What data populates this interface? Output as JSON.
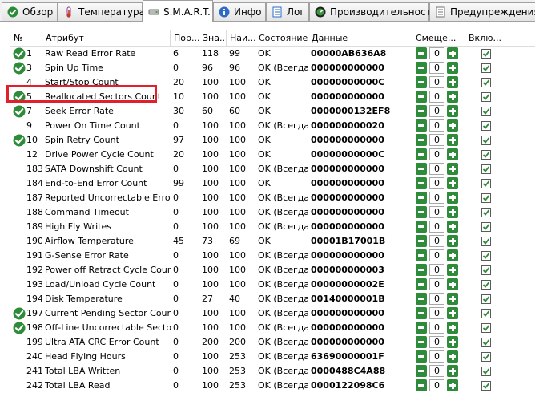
{
  "tabs": [
    {
      "label": "Обзор",
      "icon": "check-circle-icon"
    },
    {
      "label": "Температура",
      "icon": "thermometer-icon"
    },
    {
      "label": "S.M.A.R.T.",
      "icon": "drive-icon"
    },
    {
      "label": "Инфо",
      "icon": "info-icon"
    },
    {
      "label": "Лог",
      "icon": "log-icon"
    },
    {
      "label": "Производительность",
      "icon": "gauge-icon"
    },
    {
      "label": "Предупреждения",
      "icon": "warning-icon"
    }
  ],
  "columns": [
    "№",
    "Атрибут",
    "Пор...",
    "Зна...",
    "Наи...",
    "Состояние",
    "Данные",
    "Смеще...",
    "Вклю..."
  ],
  "colors": {
    "ok_green": "#2e8b3a",
    "highlight_red": "#e0202a"
  },
  "rows": [
    {
      "num": "1",
      "attr": "Raw Read Error Rate",
      "thr": "6",
      "val": "118",
      "worst": "99",
      "state": "OK",
      "data": "00000AB636A8",
      "offset": "0",
      "enabled": true,
      "ok": true
    },
    {
      "num": "3",
      "attr": "Spin Up Time",
      "thr": "0",
      "val": "96",
      "worst": "96",
      "state": "OK (Всегда...",
      "data": "000000000000",
      "offset": "0",
      "enabled": true,
      "ok": true
    },
    {
      "num": "4",
      "attr": "Start/Stop Count",
      "thr": "20",
      "val": "100",
      "worst": "100",
      "state": "OK",
      "data": "00000000000C",
      "offset": "0",
      "enabled": true,
      "ok": false
    },
    {
      "num": "5",
      "attr": "Reallocated Sectors Count",
      "thr": "10",
      "val": "100",
      "worst": "100",
      "state": "OK",
      "data": "000000000000",
      "offset": "0",
      "enabled": true,
      "ok": true
    },
    {
      "num": "7",
      "attr": "Seek Error Rate",
      "thr": "30",
      "val": "60",
      "worst": "60",
      "state": "OK",
      "data": "0000000132EF8",
      "offset": "0",
      "enabled": true,
      "ok": true
    },
    {
      "num": "9",
      "attr": "Power On Time Count",
      "thr": "0",
      "val": "100",
      "worst": "100",
      "state": "OK (Всегда...",
      "data": "000000000020",
      "offset": "0",
      "enabled": true,
      "ok": false
    },
    {
      "num": "10",
      "attr": "Spin Retry Count",
      "thr": "97",
      "val": "100",
      "worst": "100",
      "state": "OK",
      "data": "000000000000",
      "offset": "0",
      "enabled": true,
      "ok": true
    },
    {
      "num": "12",
      "attr": "Drive Power Cycle Count",
      "thr": "20",
      "val": "100",
      "worst": "100",
      "state": "OK",
      "data": "00000000000C",
      "offset": "0",
      "enabled": true,
      "ok": false
    },
    {
      "num": "183",
      "attr": "SATA Downshift Count",
      "thr": "0",
      "val": "100",
      "worst": "100",
      "state": "OK (Всегда...",
      "data": "000000000000",
      "offset": "0",
      "enabled": true,
      "ok": false
    },
    {
      "num": "184",
      "attr": "End-to-End Error Count",
      "thr": "99",
      "val": "100",
      "worst": "100",
      "state": "OK",
      "data": "000000000000",
      "offset": "0",
      "enabled": true,
      "ok": false
    },
    {
      "num": "187",
      "attr": "Reported Uncorrectable Errors",
      "thr": "0",
      "val": "100",
      "worst": "100",
      "state": "OK (Всегда...",
      "data": "000000000000",
      "offset": "0",
      "enabled": true,
      "ok": false
    },
    {
      "num": "188",
      "attr": "Command Timeout",
      "thr": "0",
      "val": "100",
      "worst": "100",
      "state": "OK (Всегда...",
      "data": "000000000000",
      "offset": "0",
      "enabled": true,
      "ok": false
    },
    {
      "num": "189",
      "attr": "High Fly Writes",
      "thr": "0",
      "val": "100",
      "worst": "100",
      "state": "OK (Всегда...",
      "data": "000000000000",
      "offset": "0",
      "enabled": true,
      "ok": false
    },
    {
      "num": "190",
      "attr": "Airflow Temperature",
      "thr": "45",
      "val": "73",
      "worst": "69",
      "state": "OK",
      "data": "00001B17001B",
      "offset": "0",
      "enabled": true,
      "ok": false
    },
    {
      "num": "191",
      "attr": "G-Sense Error Rate",
      "thr": "0",
      "val": "100",
      "worst": "100",
      "state": "OK (Всегда...",
      "data": "000000000000",
      "offset": "0",
      "enabled": true,
      "ok": false
    },
    {
      "num": "192",
      "attr": "Power off Retract Cycle Count",
      "thr": "0",
      "val": "100",
      "worst": "100",
      "state": "OK (Всегда...",
      "data": "000000000003",
      "offset": "0",
      "enabled": true,
      "ok": false
    },
    {
      "num": "193",
      "attr": "Load/Unload Cycle Count",
      "thr": "0",
      "val": "100",
      "worst": "100",
      "state": "OK (Всегда...",
      "data": "00000000002E",
      "offset": "0",
      "enabled": true,
      "ok": false
    },
    {
      "num": "194",
      "attr": "Disk Temperature",
      "thr": "0",
      "val": "27",
      "worst": "40",
      "state": "OK (Всегда...",
      "data": "00140000001B",
      "offset": "0",
      "enabled": true,
      "ok": false
    },
    {
      "num": "197",
      "attr": "Current Pending Sector Count",
      "thr": "0",
      "val": "100",
      "worst": "100",
      "state": "OK (Всегда...",
      "data": "000000000000",
      "offset": "0",
      "enabled": true,
      "ok": true
    },
    {
      "num": "198",
      "attr": "Off-Line Uncorrectable Secto...",
      "thr": "0",
      "val": "100",
      "worst": "100",
      "state": "OK (Всегда...",
      "data": "000000000000",
      "offset": "0",
      "enabled": true,
      "ok": true
    },
    {
      "num": "199",
      "attr": "Ultra ATA CRC Error Count",
      "thr": "0",
      "val": "200",
      "worst": "200",
      "state": "OK (Всегда...",
      "data": "000000000000",
      "offset": "0",
      "enabled": true,
      "ok": false
    },
    {
      "num": "240",
      "attr": "Head Flying Hours",
      "thr": "0",
      "val": "100",
      "worst": "253",
      "state": "OK (Всегда...",
      "data": "63690000001F",
      "offset": "0",
      "enabled": true,
      "ok": false
    },
    {
      "num": "241",
      "attr": "Total LBA Written",
      "thr": "0",
      "val": "100",
      "worst": "253",
      "state": "OK (Всегда...",
      "data": "0000488C4A88",
      "offset": "0",
      "enabled": true,
      "ok": false
    },
    {
      "num": "242",
      "attr": "Total LBA Read",
      "thr": "0",
      "val": "100",
      "worst": "253",
      "state": "OK (Всегда...",
      "data": "0000122098C6",
      "offset": "0",
      "enabled": true,
      "ok": false
    }
  ]
}
